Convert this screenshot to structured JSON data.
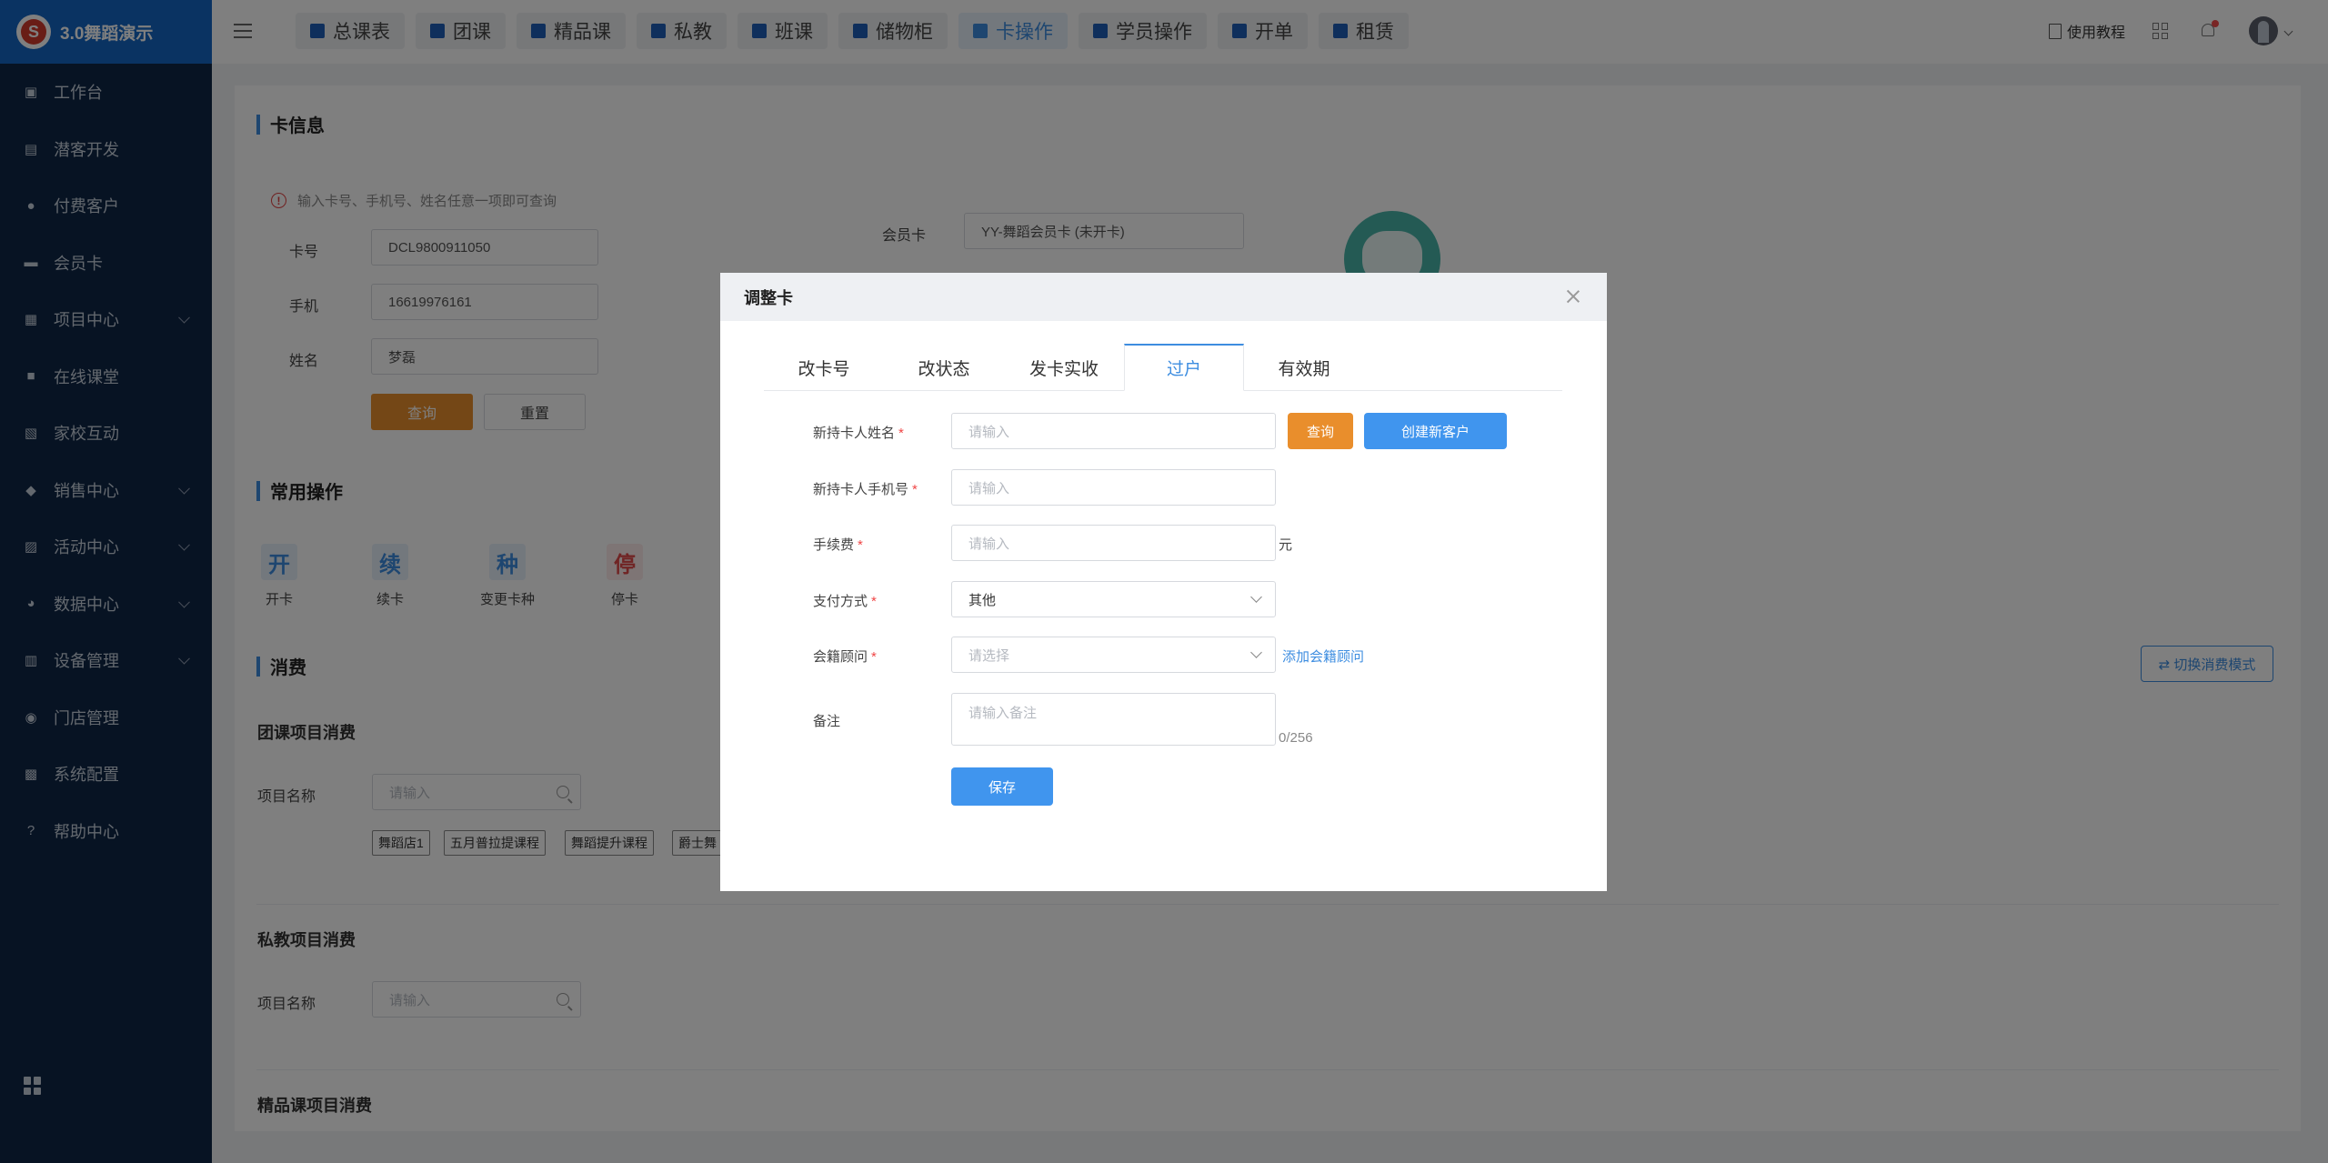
{
  "app": {
    "title": "3.0舞蹈演示",
    "logo_char": "S"
  },
  "sidebar": {
    "items": [
      {
        "label": "工作台",
        "icon": "monitor-icon"
      },
      {
        "label": "潜客开发",
        "icon": "id-card-icon"
      },
      {
        "label": "付费客户",
        "icon": "users-icon"
      },
      {
        "label": "会员卡",
        "icon": "card-icon"
      },
      {
        "label": "项目中心",
        "icon": "folder-icon"
      },
      {
        "label": "在线课堂",
        "icon": "classroom-icon"
      },
      {
        "label": "家校互动",
        "icon": "contact-icon"
      },
      {
        "label": "销售中心",
        "icon": "tag-icon"
      },
      {
        "label": "活动中心",
        "icon": "activity-icon"
      },
      {
        "label": "数据中心",
        "icon": "pie-chart-icon"
      },
      {
        "label": "设备管理",
        "icon": "device-icon"
      },
      {
        "label": "门店管理",
        "icon": "store-icon"
      },
      {
        "label": "系统配置",
        "icon": "settings-icon"
      },
      {
        "label": "帮助中心",
        "icon": "help-icon"
      }
    ]
  },
  "topbar": {
    "tabs": [
      {
        "label": "总课表"
      },
      {
        "label": "团课"
      },
      {
        "label": "精品课"
      },
      {
        "label": "私教"
      },
      {
        "label": "班课"
      },
      {
        "label": "储物柜"
      },
      {
        "label": "卡操作"
      },
      {
        "label": "学员操作"
      },
      {
        "label": "开单"
      },
      {
        "label": "租赁"
      }
    ],
    "active_tab": "卡操作",
    "tutorial": "使用教程"
  },
  "card_info": {
    "title": "卡信息",
    "hint": "输入卡号、手机号、姓名任意一项即可查询",
    "card_no_label": "卡号",
    "card_no": "DCL9800911050",
    "phone_label": "手机",
    "phone": "16619976161",
    "name_label": "姓名",
    "name": "梦磊",
    "query_btn": "查询",
    "reset_btn": "重置",
    "member_card_label": "会员卡",
    "member_card_value": "YY-舞蹈会员卡 (未开卡)"
  },
  "common_ops": {
    "title": "常用操作",
    "items": [
      {
        "char": "开",
        "label": "开卡",
        "color": "#3d8de0",
        "bg": "#e6f0fb"
      },
      {
        "char": "续",
        "label": "续卡",
        "color": "#3d8de0",
        "bg": "#e6f0fb"
      },
      {
        "char": "种",
        "label": "变更卡种",
        "color": "#3d8de0",
        "bg": "#e6f0fb"
      },
      {
        "char": "停",
        "label": "停卡",
        "color": "#e04848",
        "bg": "#fdeaea"
      }
    ]
  },
  "consume": {
    "title": "消费",
    "switch_btn": "⇄ 切换消费模式",
    "group": {
      "title": "团课项目消费",
      "label": "项目名称",
      "placeholder": "请输入",
      "tags": [
        "舞蹈店1",
        "五月普拉提课程",
        "舞蹈提升课程",
        "爵士舞"
      ]
    },
    "private": {
      "title": "私教项目消费",
      "label": "项目名称",
      "placeholder": "请输入"
    },
    "boutique": {
      "title": "精品课项目消费"
    }
  },
  "modal": {
    "title": "调整卡",
    "tabs": [
      "改卡号",
      "改状态",
      "发卡实收",
      "过户",
      "有效期"
    ],
    "active_tab": "过户",
    "fields": {
      "new_name_label": "新持卡人姓名",
      "new_name_placeholder": "请输入",
      "new_phone_label": "新持卡人手机号",
      "new_phone_placeholder": "请输入",
      "fee_label": "手续费",
      "fee_placeholder": "请输入",
      "fee_unit": "元",
      "pay_label": "支付方式",
      "pay_value": "其他",
      "advisor_label": "会籍顾问",
      "advisor_placeholder": "请选择",
      "advisor_add": "添加会籍顾问",
      "remark_label": "备注",
      "remark_placeholder": "请输入备注",
      "remark_count": "0/256"
    },
    "query_btn": "查询",
    "create_btn": "创建新客户",
    "save_btn": "保存",
    "required_mark": "*"
  }
}
